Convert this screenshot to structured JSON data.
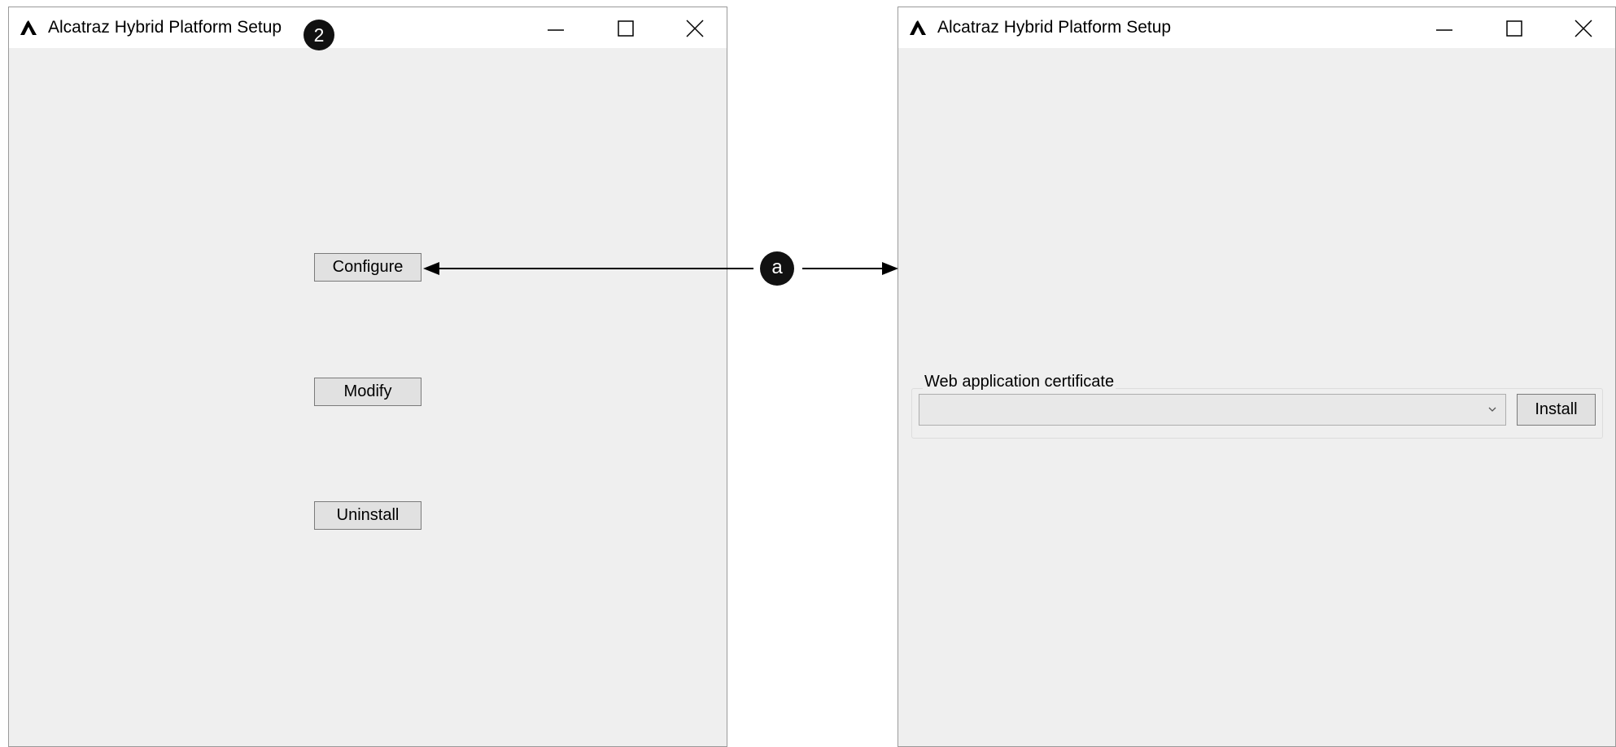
{
  "left_window": {
    "title": "Alcatraz Hybrid Platform Setup",
    "step_badge": "2",
    "buttons": {
      "configure": "Configure",
      "modify": "Modify",
      "uninstall": "Uninstall"
    },
    "controls": [
      "minimize-icon",
      "maximize-icon",
      "close-icon"
    ]
  },
  "right_window": {
    "title": "Alcatraz Hybrid Platform Setup",
    "certificate_group": {
      "legend": "Web application certificate",
      "selected_value": "",
      "install_label": "Install"
    },
    "controls": [
      "minimize-icon",
      "maximize-icon",
      "close-icon"
    ]
  },
  "annotation": {
    "label": "a"
  },
  "colors": {
    "window_bg": "#efefef",
    "titlebar_bg": "#ffffff",
    "button_bg": "#e1e1e1",
    "badge_bg": "#111111"
  }
}
